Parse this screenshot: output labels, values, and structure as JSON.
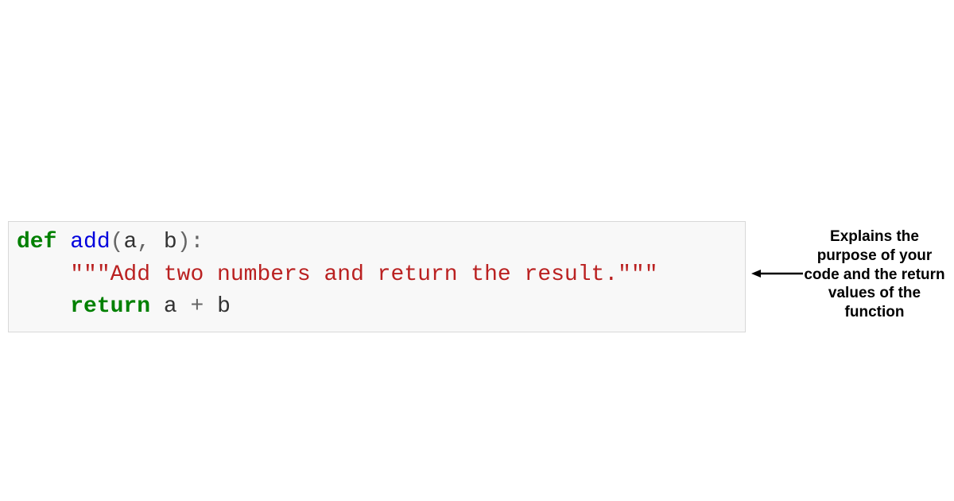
{
  "code": {
    "line1": {
      "def": "def",
      "space1": " ",
      "fn": "add",
      "lparen": "(",
      "param_a": "a",
      "comma": ",",
      "space2": " ",
      "param_b": "b",
      "rparen": ")",
      "colon": ":"
    },
    "line2": {
      "indent": "    ",
      "docstring": "\"\"\"Add two numbers and return the result.\"\"\""
    },
    "line3": {
      "indent": "    ",
      "ret": "return",
      "space": " ",
      "a": "a",
      "space2": " ",
      "plus": "+",
      "space3": " ",
      "b": "b"
    }
  },
  "annotation": {
    "text": "Explains the purpose of your code and the return values of the function"
  }
}
